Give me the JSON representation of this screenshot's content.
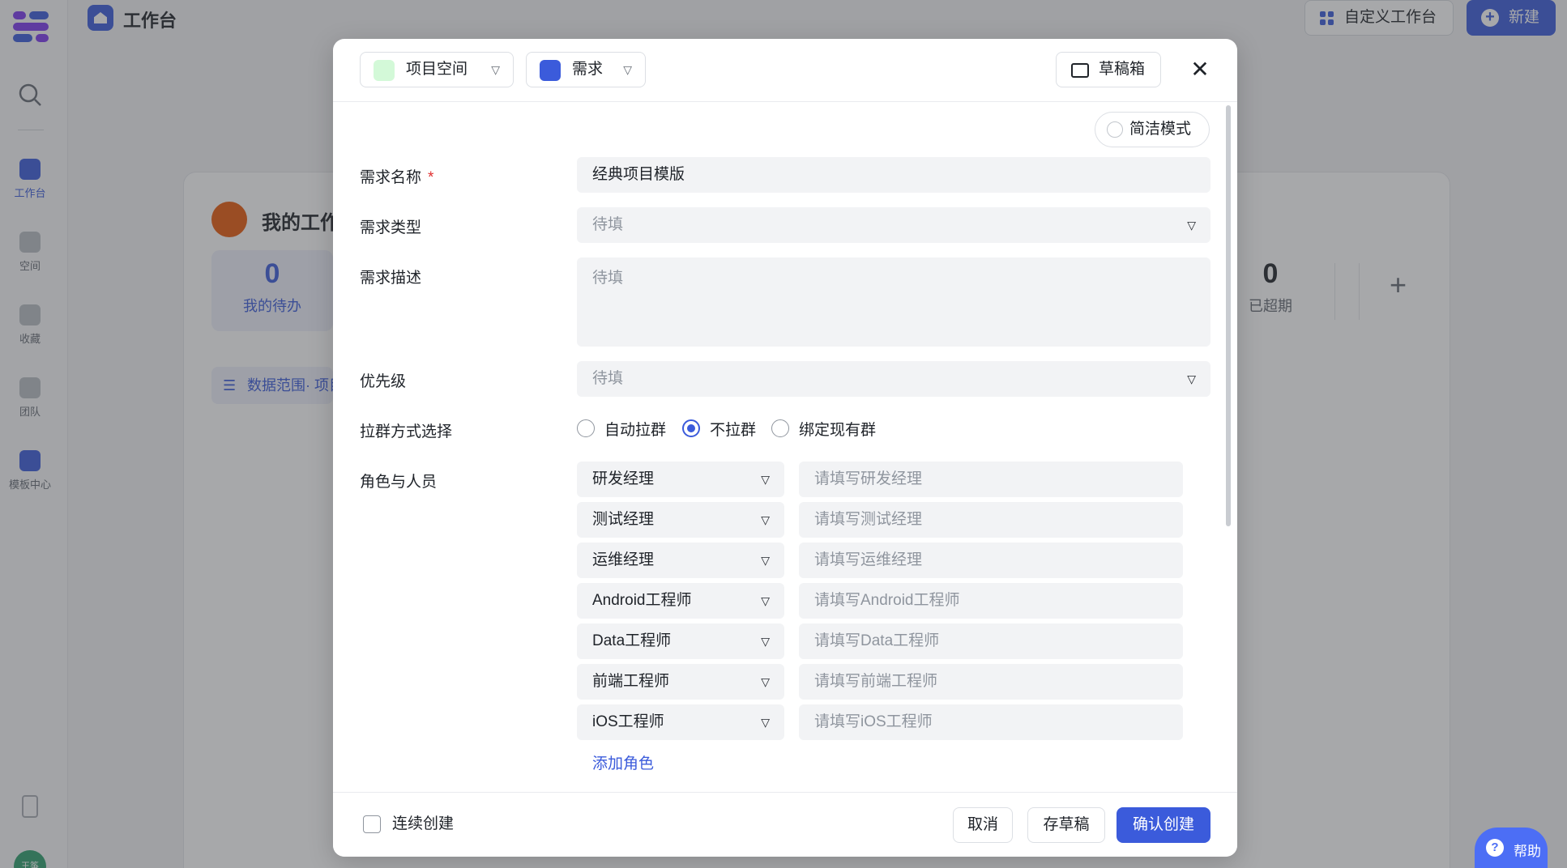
{
  "app": {
    "title": "工作台",
    "custom_workbench": "自定义工作台",
    "new_button": "新建",
    "help": "帮助",
    "avatar_text": "王筝"
  },
  "rail": [
    {
      "label": "工作台",
      "icon": "home-icon",
      "active": true
    },
    {
      "label": "空间",
      "icon": "space-icon",
      "active": false
    },
    {
      "label": "收藏",
      "icon": "star-icon",
      "active": false
    },
    {
      "label": "团队",
      "icon": "team-icon",
      "active": false
    },
    {
      "label": "模板中心",
      "icon": "template-icon",
      "active": false
    }
  ],
  "card": {
    "title": "我的工作",
    "todo_count": "0",
    "todo_label": "我的待办",
    "overdue_count": "0",
    "overdue_label": "已超期",
    "range_chip": "数据范围· 项目"
  },
  "modal": {
    "space_picker": "项目空间",
    "type_picker": "需求",
    "draft_box": "草稿箱",
    "simple_mode": "简洁模式",
    "fields": {
      "name_label": "需求名称",
      "required_mark": "*",
      "name_value": "经典项目模版",
      "type_label": "需求类型",
      "type_placeholder": "待填",
      "desc_label": "需求描述",
      "desc_placeholder": "待填",
      "priority_label": "优先级",
      "priority_placeholder": "待填",
      "group_label": "拉群方式选择",
      "group_options": [
        "自动拉群",
        "不拉群",
        "绑定现有群"
      ],
      "group_selected": "不拉群",
      "roles_label": "角色与人员"
    },
    "roles": [
      {
        "role": "研发经理",
        "placeholder": "请填写研发经理"
      },
      {
        "role": "测试经理",
        "placeholder": "请填写测试经理"
      },
      {
        "role": "运维经理",
        "placeholder": "请填写运维经理"
      },
      {
        "role": "Android工程师",
        "placeholder": "请填写Android工程师"
      },
      {
        "role": "Data工程师",
        "placeholder": "请填写Data工程师"
      },
      {
        "role": "前端工程师",
        "placeholder": "请填写前端工程师"
      },
      {
        "role": "iOS工程师",
        "placeholder": "请填写iOS工程师"
      }
    ],
    "add_role": "添加角色",
    "footer": {
      "continuous_create": "连续创建",
      "cancel": "取消",
      "save_draft": "存草稿",
      "confirm": "确认创建"
    }
  },
  "colors": {
    "accent": "#3b5bdb",
    "required": "#e03131",
    "overlay": "rgba(60,62,66,0.45)"
  }
}
